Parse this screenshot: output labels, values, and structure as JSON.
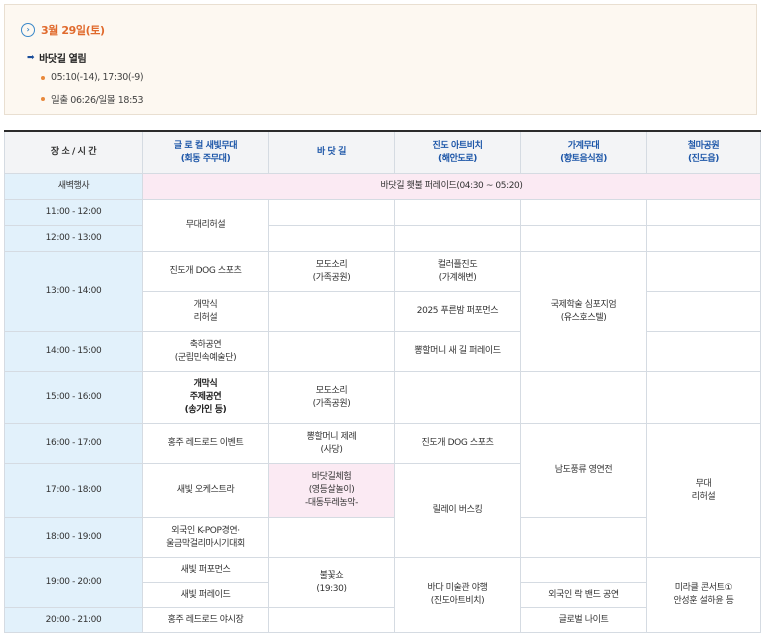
{
  "info": {
    "date": "3월 29일(토)",
    "tide_title": "바닷길 열림",
    "tide_times": "05:10(-14), 17:30(-9)",
    "sun_times": "일출 06:26/일몰 18:53"
  },
  "table": {
    "headers": [
      [
        "장 소 / 시 간"
      ],
      [
        "글 로 컬 새빛무대",
        "(회동 주무대)"
      ],
      [
        "바 닷 길"
      ],
      [
        "진도 아트비치",
        "(해안도로)"
      ],
      [
        "가계무대",
        "(향토음식점)"
      ],
      [
        "철마공원",
        "(진도읍)"
      ]
    ],
    "times": [
      "새벽행사",
      "11:00 - 12:00",
      "12:00 - 13:00",
      "13:00 - 14:00",
      "14:00 - 15:00",
      "15:00 - 16:00",
      "16:00 - 17:00",
      "17:00 - 18:00",
      "18:00 - 19:00",
      "19:00 - 20:00",
      "20:00 - 21:00"
    ],
    "dawn_event": "바닷길 횃불 퍼레이드(04:30 ~ 05:20)",
    "cells": {
      "stage_rehearsal": "무대리허설",
      "jindo_dog_sports_1": "진도개 DOG 스포츠",
      "opening_rehearsal": [
        "개막식",
        "리허설"
      ],
      "celebration": [
        "축하공연",
        "(군립민속예술단)"
      ],
      "opening_ceremony": [
        "개막식",
        "주제공연",
        "(송가인 등)"
      ],
      "red_road_event": "홍주 레드로드 이벤트",
      "saebit_orchestra": "새빛 오케스트라",
      "foreign_kpop": [
        "외국인 K-POP경연·",
        "울금막걸리마시기대회"
      ],
      "saebit_performance": "새빛 퍼포먼스",
      "saebit_parade": "새빛 퍼레이드",
      "red_road_night_market": "홍주 레드로드 야시장",
      "modo_sound_1": [
        "모도소리",
        "(가족공원)"
      ],
      "modo_sound_2": [
        "모도소리",
        "(가족공원)"
      ],
      "ppong_ritual": [
        "뽕할머니 제례",
        "(사당)"
      ],
      "badatgil_experience": [
        "바닷길체험",
        "(영등살놀이)",
        "-대동두레농악-"
      ],
      "fireworks": [
        "불꽃쇼",
        "(19:30)"
      ],
      "color_play": [
        "컬러플진도",
        "(가계해변)"
      ],
      "pureun_bam": "2025 푸른밤 퍼포먼스",
      "ppong_parade": "뽕할머니 새 길 퍼레이드",
      "jindo_dog_sports_2": "진도개 DOG 스포츠",
      "relay_busking": "릴레이 버스킹",
      "sea_art_night": [
        "바다 미술관 야행",
        "(진도아트비치)"
      ],
      "symposium": [
        "국제학술 심포지엄",
        "(유스호스텔)"
      ],
      "namdo_pungryu": "남도풍류 영연전",
      "foreign_band": "외국인 락 밴드 공연",
      "global_night": "글로벌 나이트",
      "stage_rehearsal_2": [
        "무대",
        "리허설"
      ],
      "miracle_concert": [
        "미라클 콘서트①",
        "안성훈 설하윤 등"
      ]
    }
  }
}
